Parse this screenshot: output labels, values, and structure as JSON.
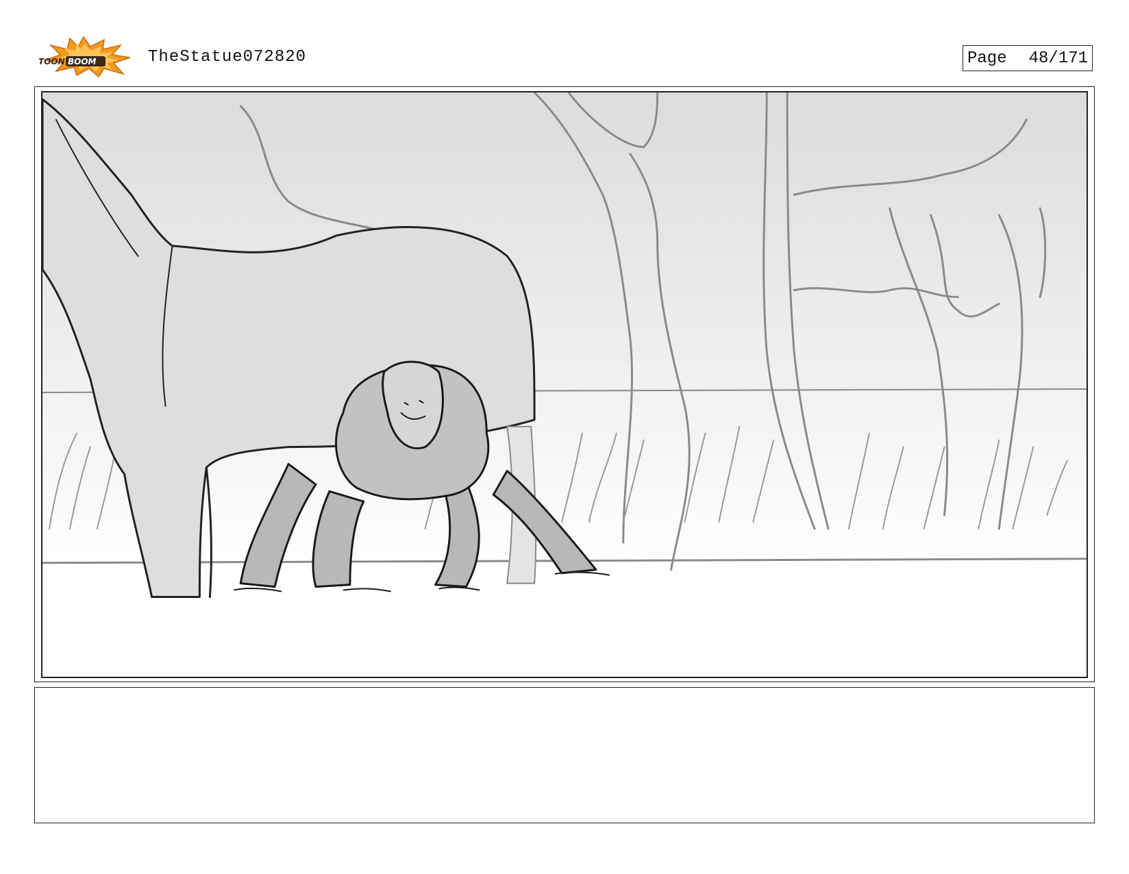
{
  "header": {
    "logo_text": "TOON BOOM",
    "project_title": "TheStatue072820",
    "page_label": "Page",
    "page_number": "48/171"
  },
  "panel": {
    "image": "storyboard-sketch"
  },
  "notes": {
    "text": ""
  },
  "colors": {
    "logo_orange": "#f39a1e",
    "logo_dark": "#3a2a1a",
    "border": "#222222"
  }
}
